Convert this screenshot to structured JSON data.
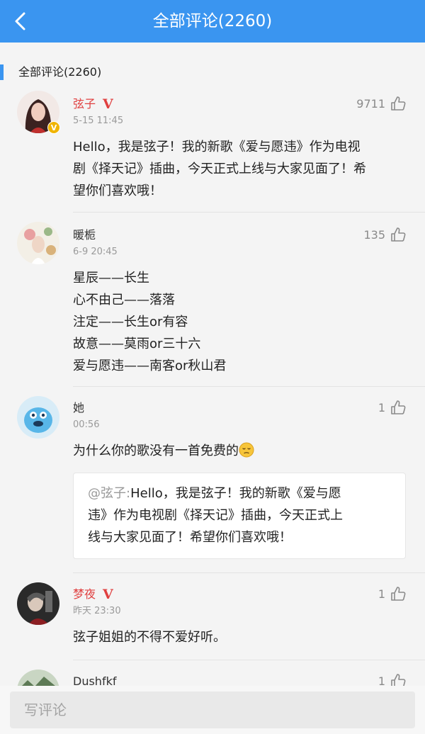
{
  "header": {
    "title": "全部评论(2260)",
    "back_icon": "chevron-left-icon"
  },
  "section": {
    "title": "全部评论(2260)"
  },
  "comments": [
    {
      "user": "弦子",
      "verified": true,
      "v_mark": "V",
      "badge": "V",
      "time": "5-15 11:45",
      "likes": "9711",
      "lines": [
        "Hello，我是弦子！我的新歌《爱与愿违》作为电视",
        "剧《择天记》插曲，今天正式上线与大家见面了！希",
        "望你们喜欢哦！"
      ]
    },
    {
      "user": "暖栀",
      "verified": false,
      "time": "6-9 20:45",
      "likes": "135",
      "lines": [
        "星辰——长生",
        "心不由己——落落",
        "注定——长生or有容",
        "故意——莫雨or三十六",
        "爱与愿违——南客or秋山君"
      ]
    },
    {
      "user": "她",
      "verified": false,
      "time": "00:56",
      "likes": "1",
      "lines": [
        "为什么你的歌没有一首免费的"
      ],
      "emoji": "pensive-face-emoji",
      "quote": {
        "at": "@弦子:",
        "lines": [
          "Hello，我是弦子！我的新歌《爱与愿",
          "违》作为电视剧《择天记》插曲，今天正式上",
          "线与大家见面了！希望你们喜欢哦！"
        ]
      }
    },
    {
      "user": "梦夜",
      "verified": true,
      "v_mark": "V",
      "time": "昨天 23:30",
      "likes": "1",
      "lines": [
        "弦子姐姐的不得不爱好听。"
      ]
    },
    {
      "user": "Dushfkf",
      "verified": false,
      "likes": "1"
    }
  ],
  "input": {
    "placeholder": "写评论"
  },
  "colors": {
    "accent": "#3a95f0",
    "vip_name": "#e04040",
    "badge": "#f0b400"
  }
}
